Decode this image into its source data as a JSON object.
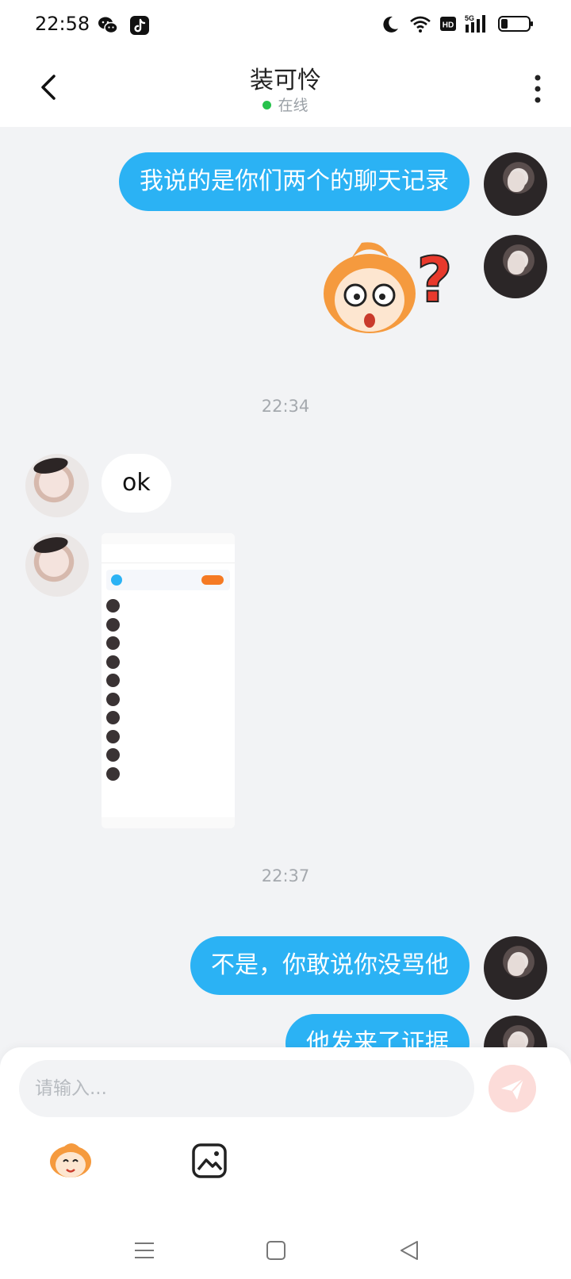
{
  "status_bar": {
    "time": "22:58",
    "icons_left": [
      "wechat-icon",
      "tiktok-icon"
    ],
    "icons_right": [
      "moon-icon",
      "wifi-icon",
      "hd-icon",
      "5g-signal-icon",
      "battery-icon"
    ],
    "network_label": "5G",
    "hd_label": "HD"
  },
  "header": {
    "title": "装可怜",
    "presence": "在线",
    "presence_color": "#27c24c"
  },
  "messages": [
    {
      "type": "text",
      "direction": "out",
      "text": "我说的是你们两个的聊天记录"
    },
    {
      "type": "sticker",
      "direction": "out",
      "name": "confused-monkey-sticker"
    },
    {
      "type": "timestamp",
      "text": "22:34"
    },
    {
      "type": "text",
      "direction": "in",
      "text": "ok"
    },
    {
      "type": "image",
      "direction": "in",
      "name": "chat-screenshot-image"
    },
    {
      "type": "timestamp",
      "text": "22:37"
    },
    {
      "type": "text",
      "direction": "out",
      "text": "不是，你敢说你没骂他"
    },
    {
      "type": "text",
      "direction": "out",
      "text": "他发来了证据"
    }
  ],
  "composer": {
    "placeholder": "请输入..."
  },
  "colors": {
    "outgoing_bubble": "#2bb2f4",
    "incoming_bubble": "#ffffff",
    "background": "#f2f3f5",
    "send_button": "#fce0de"
  }
}
